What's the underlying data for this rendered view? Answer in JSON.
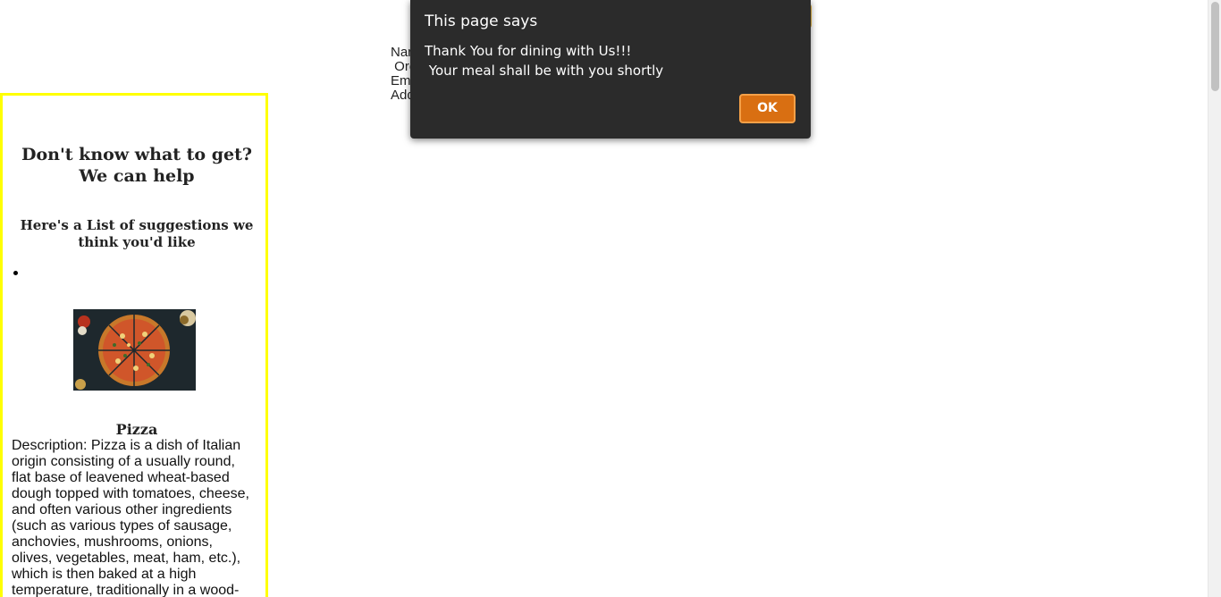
{
  "form_info": {
    "lines": [
      "Nar",
      " Ore",
      "Em",
      "Add"
    ]
  },
  "suggestions": {
    "heading": "Don't know what to get? We can help",
    "subheading": "Here's a List of suggestions we think you'd like",
    "items": [
      {
        "name": "Pizza",
        "image_icon": "pizza-photo",
        "description": "Description: Pizza is a dish of Italian origin consisting of a usually round, flat base of leavened wheat-based dough topped with tomatoes, cheese, and often various other ingredients (such as various types of sausage, anchovies, mushrooms, onions, olives, vegetables, meat, ham, etc.), which is then baked at a high temperature, traditionally in a wood-"
      }
    ]
  },
  "alert": {
    "title": "This page says",
    "message_line1": "Thank You for dining with Us!!!",
    "message_line2": " Your meal shall be with you shortly",
    "ok_label": "OK"
  },
  "colors": {
    "panel_border": "#ffff00",
    "alert_bg": "#2b2b2b",
    "ok_button": "#d96f12"
  }
}
